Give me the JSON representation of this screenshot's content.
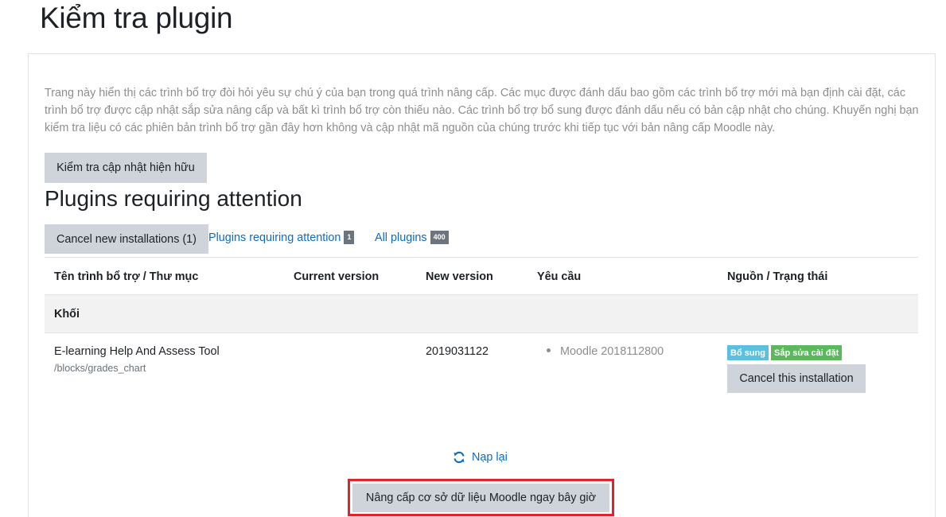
{
  "page": {
    "title": "Kiểm tra plugin",
    "intro": "Trang này hiển thị các trình bổ trợ đòi hỏi yêu sự chú ý của bạn trong quá trình nâng cấp. Các mục được đánh dấu bao gồm các trình bổ trợ mới mà bạn định cài đặt, các trình bổ trợ được cập nhật sắp sửa nâng cấp và bất kì trình bổ trợ còn thiếu nào. Các trình bổ trợ bổ sung được đánh dấu nếu có bản cập nhật cho chúng. Khuyến nghị bạn kiểm tra liệu có các phiên bản trình bổ trợ gần đây hơn không và cập nhật mã nguồn của chúng trước khi tiếp tục với bản nâng cấp Moodle này.",
    "check_updates_button": "Kiểm tra cập nhật hiện hữu"
  },
  "section": {
    "title": "Plugins requiring attention",
    "cancel_new_button": "Cancel new installations (1)",
    "filters": [
      {
        "label": "Plugins requiring attention",
        "count": "1"
      },
      {
        "label": "All plugins",
        "count": "400"
      }
    ]
  },
  "table": {
    "headers": [
      "Tên trình bổ trợ / Thư mục",
      "Current version",
      "New version",
      "Yêu cầu",
      "Nguồn / Trạng thái"
    ],
    "group": "Khối",
    "row": {
      "name": "E-learning Help And Assess Tool",
      "directory": "/blocks/grades_chart",
      "current_version": "",
      "new_version": "2019031122",
      "requirement": "Moodle 2018112800",
      "badges": [
        {
          "label": "Bổ sung",
          "color": "#5bc0de"
        },
        {
          "label": "Sắp sửa cài đặt",
          "color": "#5cb85c"
        }
      ],
      "cancel_button": "Cancel this installation"
    }
  },
  "footer": {
    "reload_label": "Nạp lại",
    "reload_icon": "refresh-icon",
    "upgrade_button": "Nâng cấp cơ sở dữ liệu Moodle ngay bây giờ",
    "highlight_color": "#e0242b"
  }
}
